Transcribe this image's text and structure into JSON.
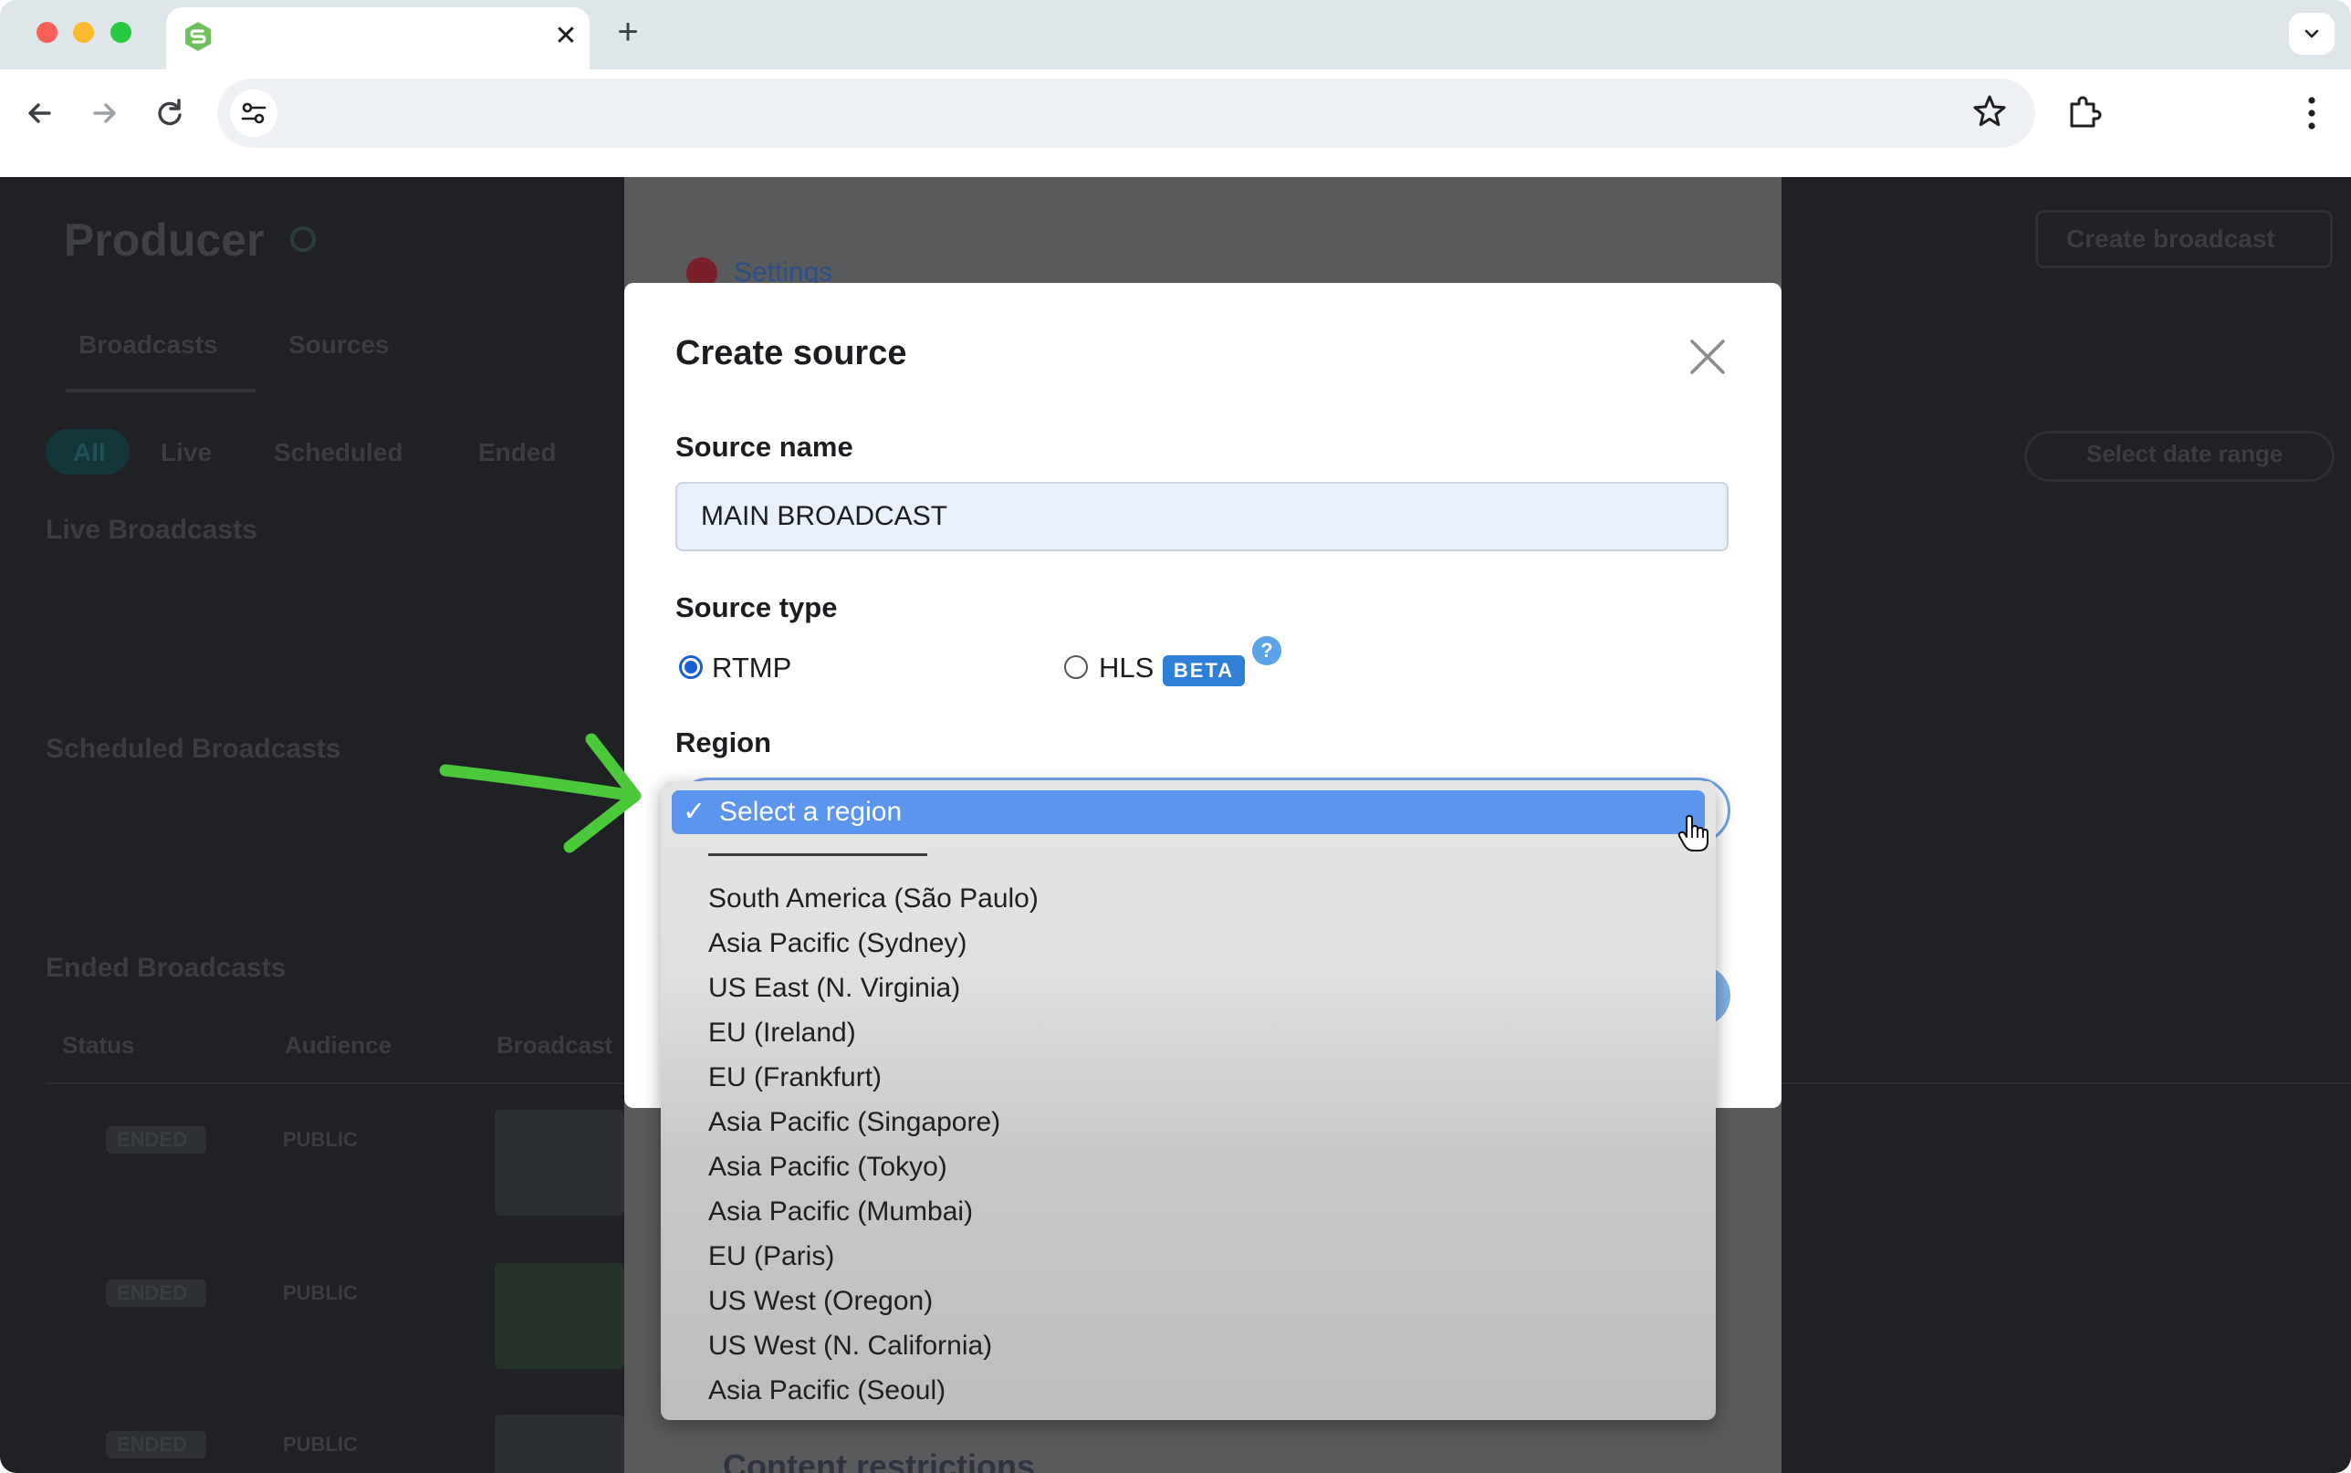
{
  "browser": {
    "tab_title": "",
    "tab_close_glyph": "✕",
    "new_tab_glyph": "+",
    "address": "",
    "icons": [
      "s-brand-favicon",
      "back-arrow-icon",
      "forward-arrow-icon",
      "reload-icon",
      "site-settings-icon",
      "bookmark-star-icon",
      "extensions-icon",
      "more-menu-icon",
      "tab-search-chevron-icon"
    ]
  },
  "background_page": {
    "title": "Producer",
    "tabs": [
      "Broadcasts",
      "Sources"
    ],
    "filters": [
      "All",
      "Live",
      "Scheduled",
      "Ended"
    ],
    "sections": [
      "Live Broadcasts",
      "Scheduled Broadcasts",
      "Ended Broadcasts"
    ],
    "table_headers": [
      "Status",
      "Audience",
      "Broadcast"
    ],
    "rows": [
      {
        "status": "ENDED",
        "audience": "PUBLIC"
      },
      {
        "status": "ENDED",
        "audience": "PUBLIC"
      },
      {
        "status": "ENDED",
        "audience": "PUBLIC"
      }
    ],
    "create_button": "Create broadcast",
    "date_range": "Select date range",
    "settings_link": "Settings",
    "content_restrictions": "Content restrictions"
  },
  "modal": {
    "title": "Create source",
    "source_name_label": "Source name",
    "source_name_value": "MAIN BROADCAST",
    "source_type_label": "Source type",
    "source_types": [
      {
        "label": "RTMP",
        "checked": true
      },
      {
        "label": "HLS",
        "checked": false
      }
    ],
    "beta_badge": "BETA",
    "help_glyph": "?",
    "region_label": "Region"
  },
  "region_dropdown": {
    "check_glyph": "✓",
    "selected": "Select a region",
    "options": [
      "South America (São Paulo)",
      "Asia Pacific (Sydney)",
      "US East (N. Virginia)",
      "EU (Ireland)",
      "EU (Frankfurt)",
      "Asia Pacific (Singapore)",
      "Asia Pacific (Tokyo)",
      "Asia Pacific (Mumbai)",
      "EU (Paris)",
      "US West (Oregon)",
      "US West (N. California)",
      "Asia Pacific (Seoul)"
    ]
  },
  "colors": {
    "annotation_arrow": "#4cc93a",
    "selected_option": "#5b95ee",
    "beta_badge": "#2f7fd7"
  }
}
